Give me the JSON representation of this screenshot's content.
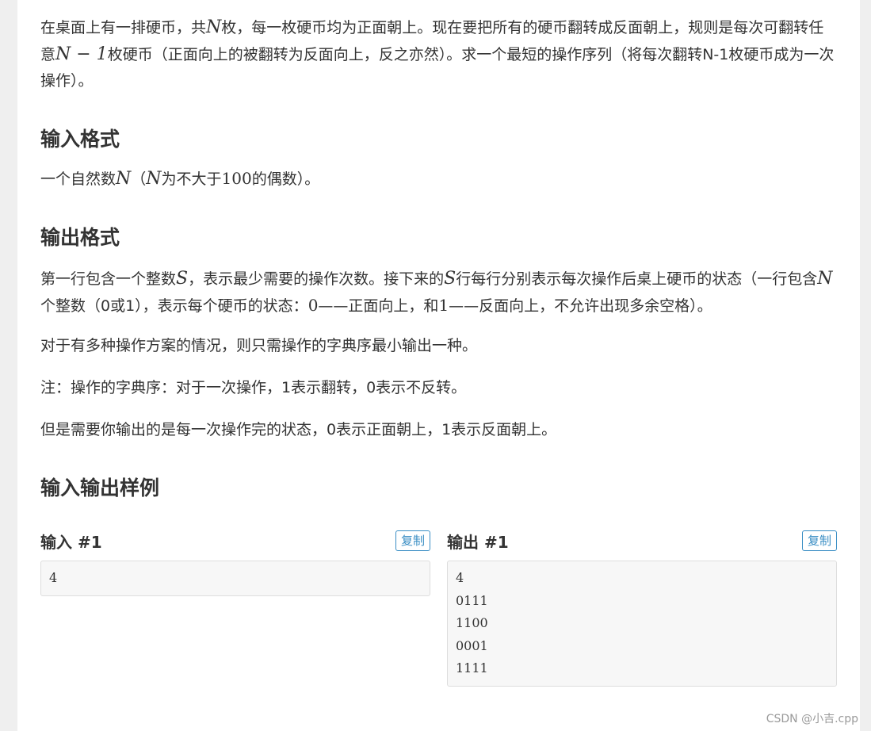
{
  "description": {
    "line1_a": "在桌面上有一排硬币，共",
    "var_n": "N",
    "line1_b": "枚，每一枚硬币均为正面朝上。现在要把所有的硬币翻转成反面朝上，规则是每次可翻转任意",
    "expr_n_minus_1": "N − 1",
    "line1_c": "枚硬币（正面向上的被翻转为反面向上，反之亦然）。求一个最短的操作序列（将每次翻转N-1枚硬币成为一次操作）。"
  },
  "input_format": {
    "heading": "输入格式",
    "text_a": "一个自然数",
    "var_n": "N",
    "text_b": "（",
    "var_n2": "N",
    "text_c": "为不大于",
    "num_100": "100",
    "text_d": "的偶数）。"
  },
  "output_format": {
    "heading": "输出格式",
    "p1_a": "第一行包含一个整数",
    "var_s": "S",
    "p1_b": "，表示最少需要的操作次数。接下来的",
    "var_s2": "S",
    "p1_c": "行每行分别表示每次操作后桌上硬币的状态（一行包含",
    "var_n": "N",
    "p1_d": "个整数（0或1），表示每个硬币的状态：",
    "num_0": "0",
    "p1_e": "——正面向上，和",
    "num_1": "1",
    "p1_f": "——反面向上，不允许出现多余空格）。",
    "p2": "对于有多种操作方案的情况，则只需操作的字典序最小输出一种。",
    "p3": "注：操作的字典序：对于一次操作，1表示翻转，0表示不反转。",
    "p4": "但是需要你输出的是每一次操作完的状态，0表示正面朝上，1表示反面朝上。"
  },
  "samples": {
    "heading": "输入输出样例",
    "input": {
      "title": "输入 #1",
      "copy_label": "复制",
      "content": "4"
    },
    "output": {
      "title": "输出 #1",
      "copy_label": "复制",
      "content": "4\n0111\n1100\n0001\n1111"
    }
  },
  "watermark": "CSDN @小吉.cpp",
  "colors": {
    "accent": "#3a8ec4",
    "text": "#333333",
    "code_bg": "#f7f7f7",
    "page_bg": "#efefef"
  }
}
